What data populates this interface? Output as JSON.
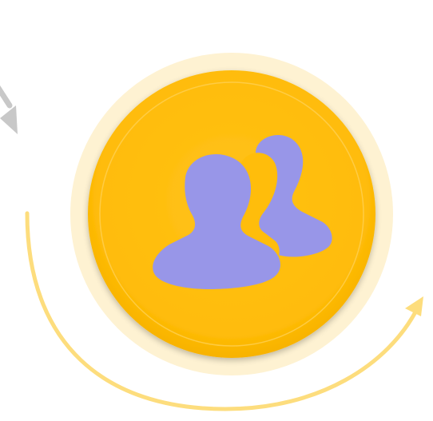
{
  "colors": {
    "background": "#ffffff",
    "outer_halo": "#FEF2D2",
    "circle_fill": "#FFBD0B",
    "circle_inner_ring": "#FFD35C",
    "users_icon": "#9896E8",
    "arc_arrow": "#FDDD7D",
    "gray_arrow": "#C8C8C8"
  },
  "icons": {
    "center": "users-icon",
    "cycle": "curved-arrow-icon",
    "incoming": "gray-arrow-icon"
  }
}
